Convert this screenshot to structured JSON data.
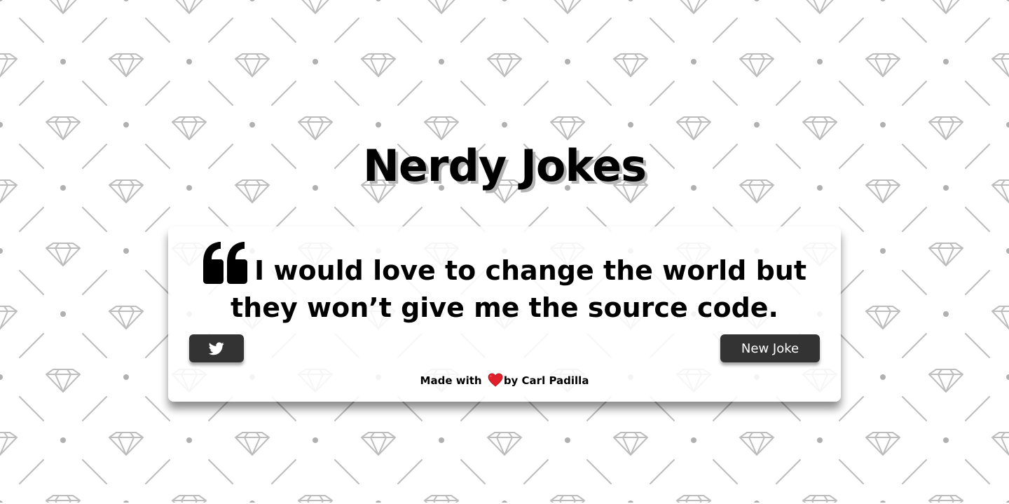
{
  "page": {
    "title": "Nerdy Jokes"
  },
  "joke": {
    "text": "I would love to change the world but they won’t give me the source code.",
    "quote_icon": "quote-left-icon"
  },
  "buttons": {
    "tweet_icon": "twitter-icon",
    "new_joke_label": "New Joke"
  },
  "footer": {
    "made_with": "Made with",
    "heart_icon": "heart-icon",
    "by_author": "by Carl Padilla"
  },
  "colors": {
    "button_bg": "#333333",
    "button_text": "#ffffff",
    "title_shadow": "#b3b3b3",
    "pattern": "#bdbdbd",
    "heart": "#e0202b"
  }
}
